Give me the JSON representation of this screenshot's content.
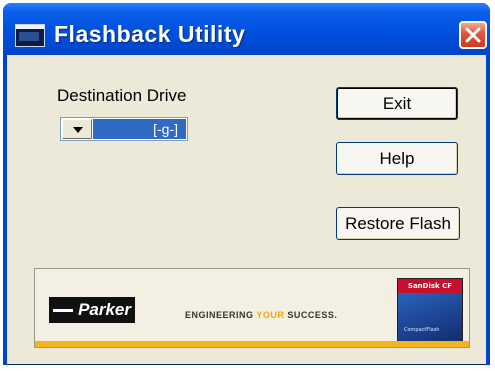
{
  "window": {
    "title": "Flashback Utility",
    "colors": {
      "titlebar": "#0050de",
      "highlight": "#316ac5",
      "face": "#ece9d8",
      "close": "#e0543b"
    }
  },
  "destination": {
    "label": "Destination Drive",
    "selected": "[-g-]"
  },
  "buttons": {
    "exit": "Exit",
    "help": "Help",
    "restore": "Restore Flash"
  },
  "banner": {
    "logo_text": "Parker",
    "tagline_pre": "ENGINEERING ",
    "tagline_highlight": "YOUR",
    "tagline_post": " SUCCESS.",
    "card_brand": "SanDisk CF",
    "card_sub": "CompactFlash"
  },
  "icons": [
    "app-icon",
    "close-icon",
    "dropdown-arrow-icon",
    "compact-flash-card-icon"
  ]
}
